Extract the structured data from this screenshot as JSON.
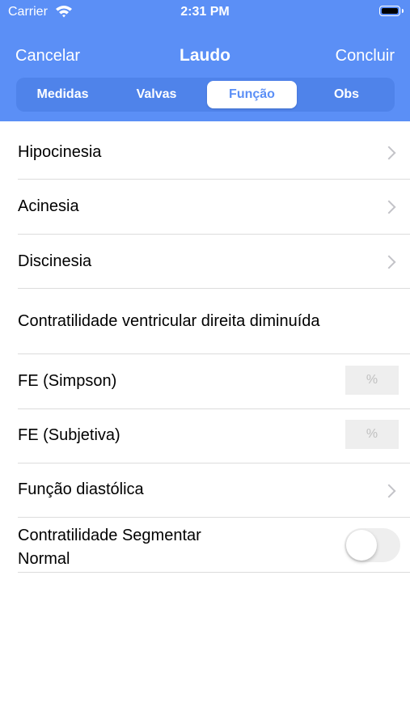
{
  "status_bar": {
    "carrier": "Carrier",
    "time": "2:31 PM",
    "battery_level": 1.0
  },
  "nav": {
    "left": "Cancelar",
    "title": "Laudo",
    "right": "Concluir"
  },
  "tabs": [
    {
      "label": "Medidas",
      "active": false
    },
    {
      "label": "Valvas",
      "active": false
    },
    {
      "label": "Função",
      "active": true
    },
    {
      "label": "Obs",
      "active": false
    }
  ],
  "rows": {
    "hipocinesia": {
      "label": "Hipocinesia"
    },
    "acinesia": {
      "label": "Acinesia"
    },
    "discinesia": {
      "label": "Discinesia"
    },
    "contratilidade_vd": {
      "label": "Contratilidade ventricular direita diminuída"
    },
    "fe_simpson": {
      "label": "FE (Simpson)",
      "placeholder": "%"
    },
    "fe_subjetiva": {
      "label": "FE (Subjetiva)",
      "placeholder": "%"
    },
    "funcao_diastolica": {
      "label": "Função diastólica"
    },
    "contratilidade_segmentar": {
      "label_line1": "Contratilidade Segmentar",
      "label_line2": "Normal",
      "toggle_on": false
    }
  },
  "colors": {
    "accent": "#5b8ff6",
    "segment_bg": "#4f83ea",
    "separator": "#dcdcdc",
    "chevron": "#c3c3c8"
  }
}
